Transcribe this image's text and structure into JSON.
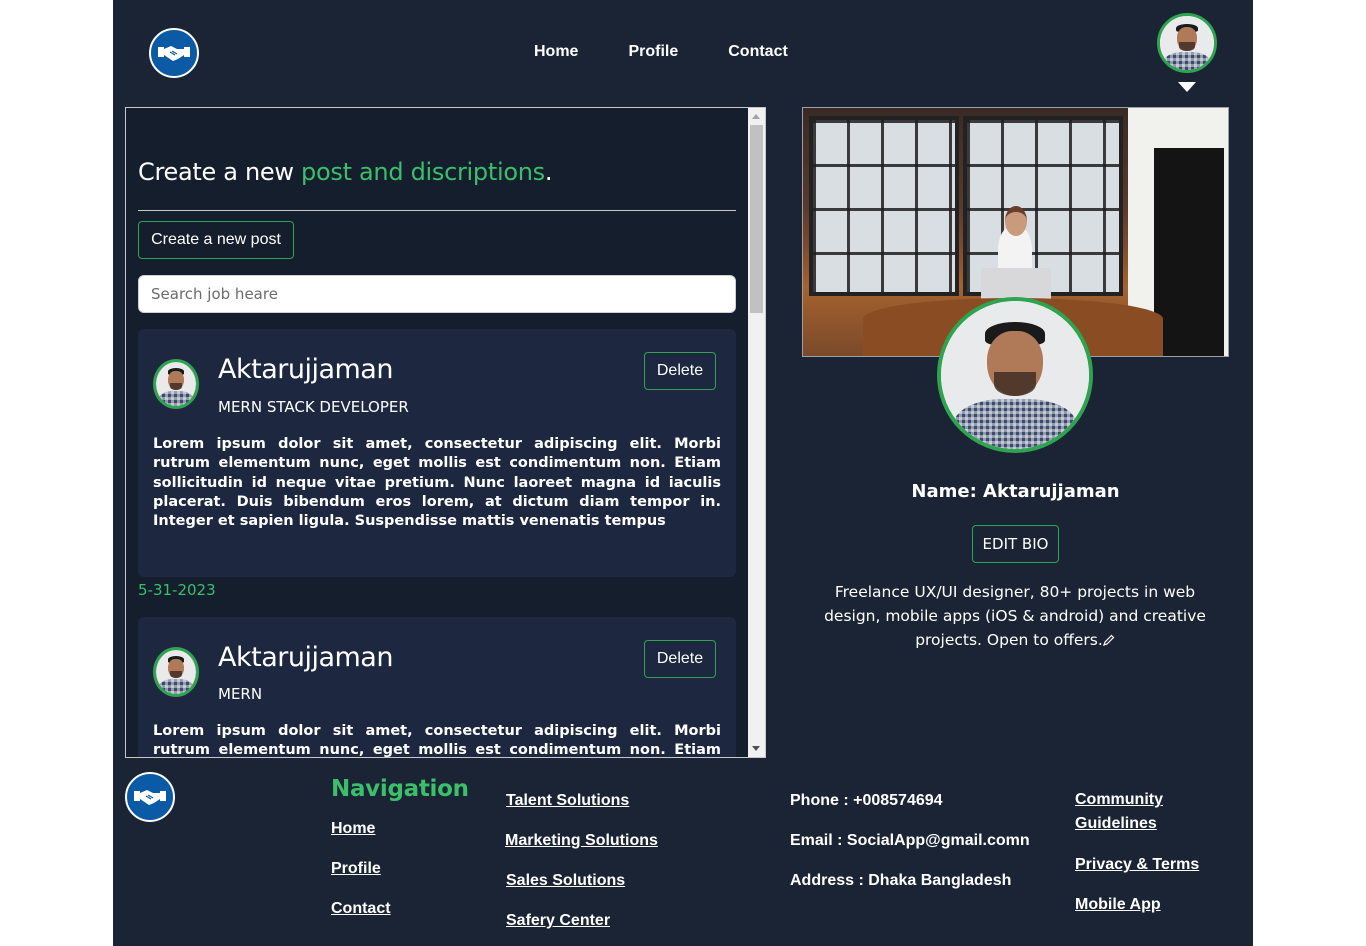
{
  "header": {
    "logo_icon": "handshake-icon",
    "nav": [
      "Home",
      "Profile",
      "Contact"
    ],
    "avatar_icon": "user-avatar",
    "menu_icon": "caret-down-icon"
  },
  "composer": {
    "heading_prefix": "Create a new ",
    "heading_accent": "post and discriptions",
    "heading_suffix": ".",
    "create_button": "Create a new post",
    "search_placeholder": "Search job heare"
  },
  "posts": [
    {
      "name": "Aktarujjaman",
      "role": "MERN STACK DEVELOPER",
      "delete_label": "Delete",
      "body": "Lorem ipsum dolor sit amet, consectetur adipiscing elit. Morbi rutrum elementum nunc, eget mollis est condimentum non. Etiam sollicitudin id neque vitae pretium. Nunc laoreet magna id iaculis placerat. Duis bibendum eros lorem, at dictum diam tempor in. Integer et sapien ligula. Suspendisse mattis venenatis tempus",
      "date": "5-31-2023"
    },
    {
      "name": "Aktarujjaman",
      "role": "MERN",
      "delete_label": "Delete",
      "body": "Lorem ipsum dolor sit amet, consectetur adipiscing elit. Morbi rutrum elementum nunc, eget mollis est condimentum non. Etiam sollicitudin id"
    }
  ],
  "profile": {
    "name_line": "Name: Aktarujjaman",
    "edit_bio_label": "EDIT BIO",
    "bio": "Freelance UX/UI designer, 80+ projects  in web design, mobile apps (iOS & android) and creative projects. Open to offers.",
    "edit_icon": "pencil-icon"
  },
  "footer": {
    "navigation_title": "Navigation",
    "navigation": [
      "Home",
      "Profile",
      "Contact"
    ],
    "solutions": [
      "Talent Solutions",
      "Marketing Solutions",
      "Sales Solutions",
      "Safery Center"
    ],
    "contact": [
      "Phone : +008574694",
      "Email : SocialApp@gmail.comn",
      "Address : Dhaka Bangladesh"
    ],
    "links": [
      "Community Guidelines",
      "Privacy & Terms",
      "Mobile App"
    ]
  },
  "colors": {
    "background": "#1b2434",
    "accent_green": "#2ea44f",
    "logo_blue": "#0b5aa5"
  }
}
